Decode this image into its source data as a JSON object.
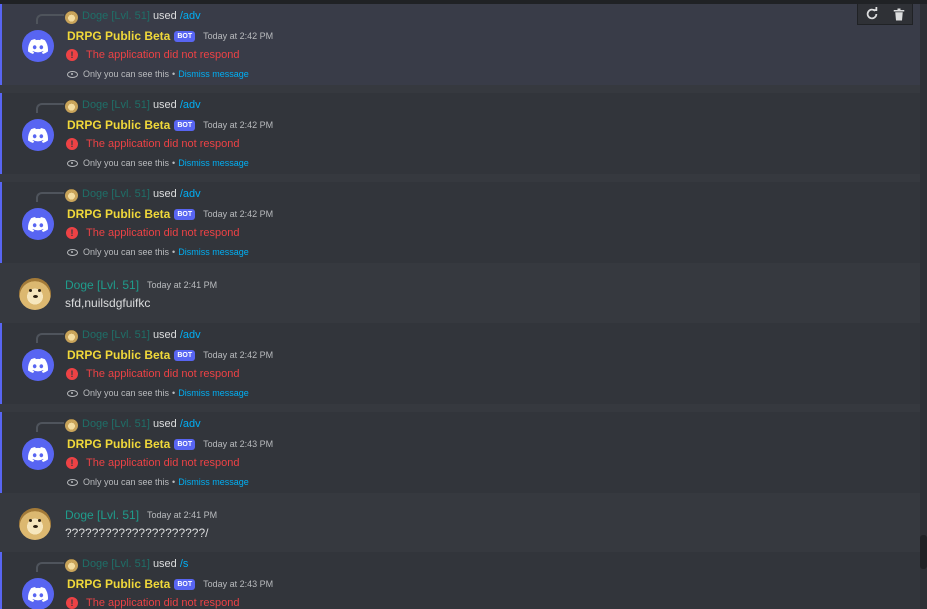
{
  "command_user": "Doge [Lvl. 51]",
  "used_text": "used",
  "bot_name": "DRPG Public Beta",
  "bot_badge": "BOT",
  "error_text": "The application did not respond",
  "only_you_text": "Only you can see this",
  "separator": "•",
  "dismiss_text": "Dismiss message",
  "messages": [
    {
      "command": "/adv",
      "time": "Today at 2:42 PM"
    },
    {
      "command": "/adv",
      "time": "Today at 2:42 PM"
    },
    {
      "command": "/adv",
      "time": "Today at 2:42 PM"
    },
    {
      "user": "Doge [Lvl. 51]",
      "time": "Today at 2:41 PM",
      "text": "sfd,nuilsdgfuifkc"
    },
    {
      "command": "/adv",
      "time": "Today at 2:42 PM"
    },
    {
      "command": "/adv",
      "time": "Today at 2:43 PM"
    },
    {
      "user": "Doge [Lvl. 51]",
      "time": "Today at 2:41 PM",
      "text": "?????????????????????/"
    },
    {
      "command": "/s",
      "time": "Today at 2:43 PM"
    }
  ],
  "colors": {
    "background": "#36393f",
    "ephemeral_background": "#32353b",
    "bot_name": "#f0d83a",
    "user_name": "#1f9c8c",
    "error": "#ed4245",
    "link": "#00aff4",
    "blurple": "#5865f2"
  },
  "toolbar_icons": [
    "refresh-icon",
    "trash-icon"
  ]
}
